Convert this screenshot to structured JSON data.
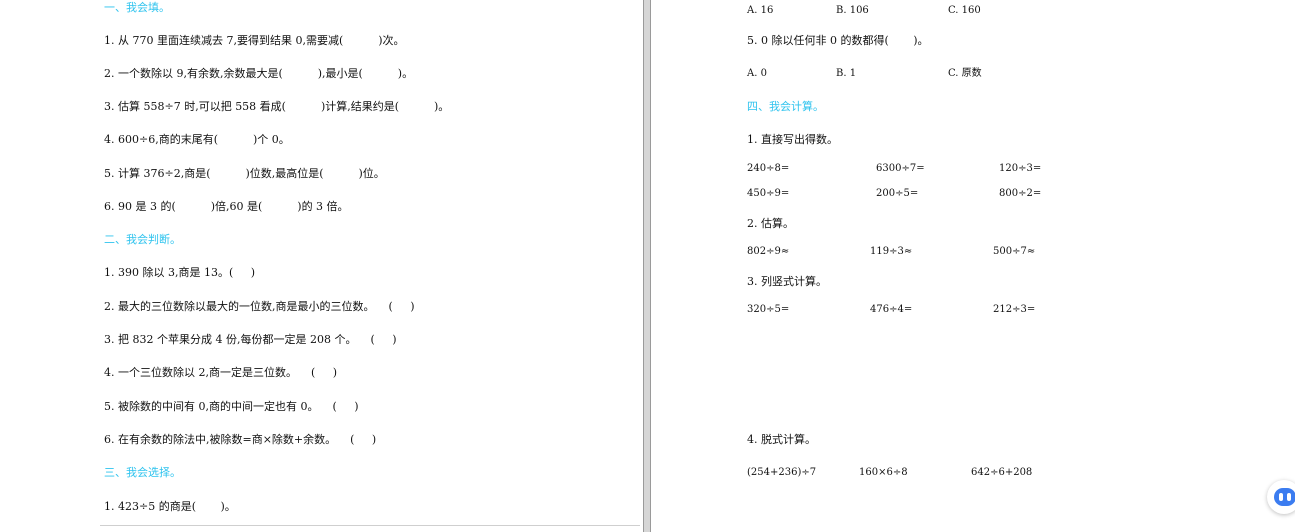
{
  "left_page": {
    "sections": [
      {
        "heading": "一、我会填。",
        "items": [
          "1. 从 770 里面连续减去 7,要得到结果 0,需要减(          )次。",
          "2. 一个数除以 9,有余数,余数最大是(          ),最小是(          )。",
          "3. 估算 558÷7 时,可以把 558 看成(          )计算,结果约是(          )。",
          "4. 600÷6,商的末尾有(          )个 0。",
          "5. 计算 376÷2,商是(          )位数,最高位是(          )位。",
          "6. 90 是 3 的(          )倍,60 是(          )的 3 倍。"
        ]
      },
      {
        "heading": "二、我会判断。",
        "items": [
          "1. 390 除以 3,商是 13。(     )",
          "2. 最大的三位数除以最大的一位数,商是最小的三位数。    (     )",
          "3. 把 832 个苹果分成 4 份,每份都一定是 208 个。    (     )",
          "4. 一个三位数除以 2,商一定是三位数。    (     )",
          "5. 被除数的中间有 0,商的中间一定也有 0。    (     )",
          "6. 在有余数的除法中,被除数=商×除数+余数。    (     )"
        ]
      },
      {
        "heading": "三、我会选择。",
        "items": [
          "1. 423÷5 的商是(       )。"
        ]
      }
    ]
  },
  "right_page": {
    "q4_options": [
      "A. 16",
      "B. 106",
      "C. 160"
    ],
    "q5_text": "5. 0 除以任何非 0 的数都得(       )。",
    "q5_options": [
      "A. 0",
      "B. 1",
      "C. 原数"
    ],
    "section4_heading": "四、我会计算。",
    "sub1_title": "1. 直接写出得数。",
    "direct_rows": [
      [
        "240÷8=",
        "6300÷7=",
        "120÷3="
      ],
      [
        "450÷9=",
        "200÷5=",
        "800÷2="
      ]
    ],
    "sub2_title": "2. 估算。",
    "estimate_row": [
      "802÷9≈",
      "119÷3≈",
      "500÷7≈"
    ],
    "sub3_title": "3. 列竖式计算。",
    "vertical_row": [
      "320÷5=",
      "476÷4=",
      "212÷3="
    ],
    "sub4_title": "4. 脱式计算。",
    "stepwise_row": [
      "(254+236)÷7",
      "160×6÷8",
      "642÷6+208"
    ]
  },
  "assistant": {
    "icon": "assistant-bot-icon",
    "color": "#3b7cf0"
  },
  "colors": {
    "heading": "#2ec3ee",
    "text": "#111111"
  }
}
